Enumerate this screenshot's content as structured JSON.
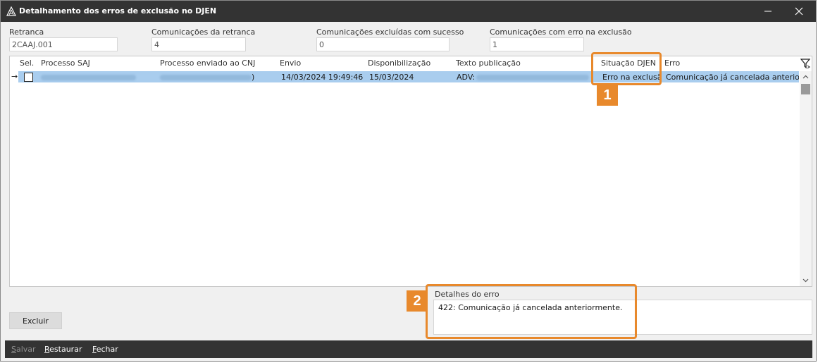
{
  "window": {
    "title": "Detalhamento dos erros de exclusão no DJEN",
    "minimize_glyph": "—",
    "close_glyph": "✕"
  },
  "fields": {
    "retranca": {
      "label": "Retranca",
      "value": "2CAAJ.001"
    },
    "comunicacoes_retranca": {
      "label": "Comunicações da retranca",
      "value": "4"
    },
    "excluidas_sucesso": {
      "label": "Comunicações excluídas com sucesso",
      "value": "0"
    },
    "erro_exclusao": {
      "label": "Comunicações com erro na exclusão",
      "value": "1"
    }
  },
  "grid": {
    "columns": [
      "Sel.",
      "Processo SAJ",
      "Processo enviado ao CNJ",
      "Envio",
      "Disponibilização",
      "Texto publicação",
      "Situação DJEN",
      "Erro"
    ],
    "rows": [
      {
        "arrow": "→",
        "checked": false,
        "processo_saj": "",
        "processo_cnj_suffix": ")",
        "envio": "14/03/2024 19:49:46",
        "disponibilizacao": "15/03/2024",
        "texto_publicacao": "ADV:",
        "situacao": "Erro na exclusão",
        "erro": "Comunicação já cancelada anteriormente."
      }
    ]
  },
  "details": {
    "label": "Detalhes do erro",
    "text": "422: Comunicação já cancelada anteriormente."
  },
  "buttons": {
    "excluir": "Excluir"
  },
  "bottombar": {
    "salvar_first": "S",
    "salvar_rest": "alvar",
    "restaurar_first": "R",
    "restaurar_rest": "estaurar",
    "fechar_first": "F",
    "fechar_rest": "echar"
  },
  "callouts": {
    "one": "1",
    "two": "2"
  },
  "colors": {
    "titlebar": "#333333",
    "selected_row": "#a9cdee",
    "callout": "#e8892c"
  }
}
